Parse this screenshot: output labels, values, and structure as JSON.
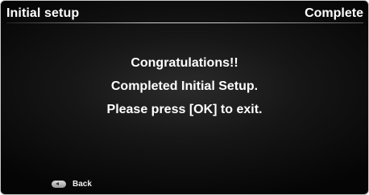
{
  "header": {
    "title": "Initial setup",
    "status": "Complete"
  },
  "message": {
    "lines": [
      "Congratulations!!",
      "Completed Initial Setup.",
      "Please press [OK] to exit."
    ]
  },
  "footer": {
    "back_icon": "back-key-icon",
    "back_label": "Back"
  }
}
